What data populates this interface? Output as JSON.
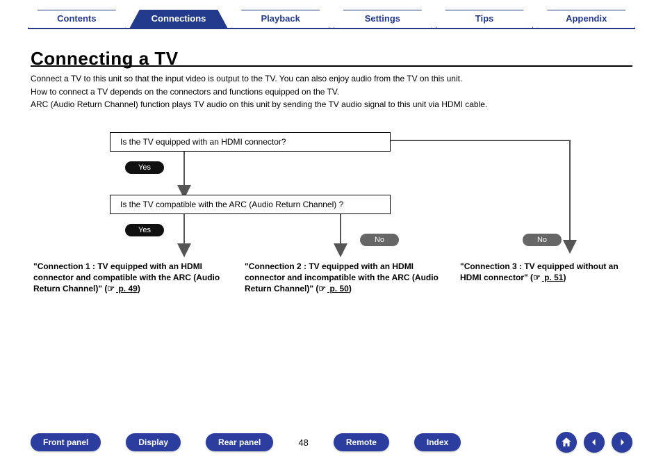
{
  "tabs": [
    "Contents",
    "Connections",
    "Playback",
    "Settings",
    "Tips",
    "Appendix"
  ],
  "active_tab_index": 1,
  "title": "Connecting a TV",
  "intro_lines": [
    "Connect a TV to this unit so that the input video is output to the TV. You can also enjoy audio from the TV on this unit.",
    "How to connect a TV depends on the connectors and functions equipped on the TV.",
    "ARC (Audio Return Channel) function plays TV audio on this unit by sending the TV audio signal to this unit via HDMI cable."
  ],
  "flow": {
    "q1": "Is the TV equipped with an HDMI connector?",
    "q2": "Is the TV compatible with the ARC (Audio Return Channel) ?",
    "yes": "Yes",
    "no": "No"
  },
  "connections": [
    {
      "text": "\"Connection 1 : TV equipped with an HDMI connector and compatible with the ARC (Audio Return Channel)\" (",
      "page_label": " p. 49",
      "tail": ")"
    },
    {
      "text": "\"Connection 2 : TV equipped with an HDMI connector and incompatible with the ARC (Audio Return Channel)\" (",
      "page_label": " p. 50",
      "tail": ")"
    },
    {
      "text": "\"Connection 3 : TV equipped without an HDMI connector\" (",
      "page_label": " p. 51",
      "tail": ")"
    }
  ],
  "bottom_nav": [
    "Front panel",
    "Display",
    "Rear panel"
  ],
  "bottom_nav_right": [
    "Remote",
    "Index"
  ],
  "page_number": "48",
  "icons": {
    "home": "home-icon",
    "prev": "arrow-left-icon",
    "next": "arrow-right-icon",
    "hand": "☞"
  }
}
